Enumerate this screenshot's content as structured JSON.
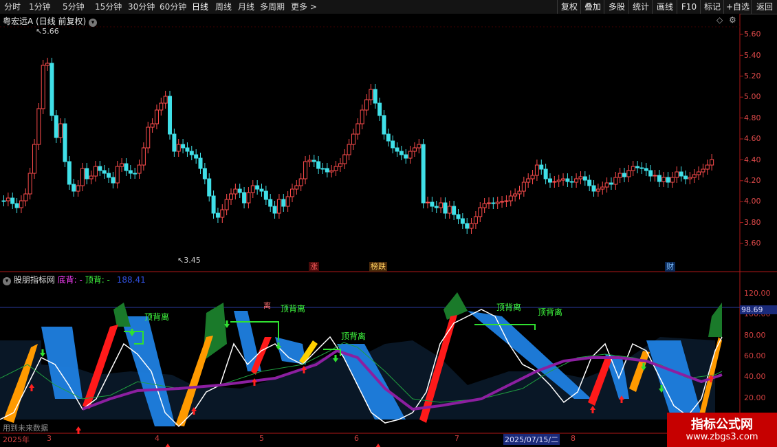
{
  "toolbar": {
    "periods": [
      "分时",
      "1分钟",
      "5分钟",
      "15分钟",
      "30分钟",
      "60分钟",
      "日线",
      "周线",
      "月线",
      "多周期",
      "更多 >"
    ],
    "active_period": "日线",
    "actions": [
      "复权",
      "叠加",
      "多股",
      "统计",
      "画线",
      "F10",
      "标记",
      "+自选",
      "返回"
    ]
  },
  "price_panel": {
    "stock_name": "粤宏远A",
    "period_note": "(日线 前复权)",
    "high_mark": "5.66",
    "low_mark": "3.45",
    "y_axis": [
      "5.60",
      "5.40",
      "5.20",
      "5.00",
      "4.80",
      "4.60",
      "4.40",
      "4.20",
      "4.00",
      "3.80",
      "3.60"
    ],
    "event_tags": [
      "涨",
      "榜跌",
      "财"
    ]
  },
  "indicator_panel": {
    "title": "股朋指标网",
    "legend_bottom": "底背: -",
    "legend_top": "顶背: -",
    "legend_value": "188.41",
    "y_axis": [
      "120.00",
      "100.00",
      "80.00",
      "60.00",
      "40.00",
      "20.00"
    ],
    "current_value": "98.69",
    "signal_text": "顶背离",
    "divergence_text": "离",
    "future_note": "用到未来数据"
  },
  "date_axis": {
    "year": "2025年",
    "months": [
      "3",
      "4",
      "5",
      "6",
      "7",
      "8"
    ],
    "cursor_date": "2025/07/15/二"
  },
  "watermark": {
    "title": "指标公式网",
    "url": "www.zbgs3.com"
  },
  "colors": {
    "up_candle": "#ff4d4d",
    "down_candle": "#40e0e8",
    "axis_red": "#c02020",
    "indicator_blue": "#1f7fe0",
    "indicator_green": "#1a7a2a",
    "indicator_red": "#ff1a1a",
    "indicator_orange": "#ff9a00",
    "indicator_yellow": "#ffd000",
    "purple_line": "#8c1fa0",
    "label_green": "#30ff30",
    "watermark_bg": "#c60000"
  }
}
